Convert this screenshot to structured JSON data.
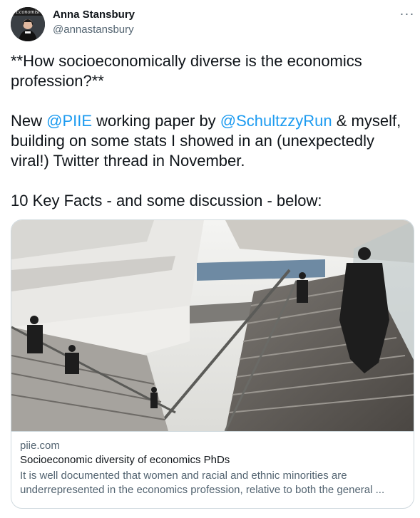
{
  "author": {
    "name": "Anna Stansbury",
    "handle": "@annastansbury",
    "avatar_icon": "person-with-economist-banner"
  },
  "more_button": {
    "label": "···",
    "icon": "more-horizontal-icon"
  },
  "tweet": {
    "line1": "**How socioeconomically diverse is the economics profession?**",
    "line2_prefix": "New ",
    "mention1": "@PIIE",
    "line2_mid": " working paper by ",
    "mention2": "@SchultzzyRun",
    "line2_suffix": " & myself, building on some stats I showed in an (unexpectedly viral!) Twitter thread in November.",
    "line3": "10 Key Facts - and some discussion - below:"
  },
  "card": {
    "image_description_icon": "building-staircase-photo",
    "domain": "piie.com",
    "title": "Socioeconomic diversity of economics PhDs",
    "description": "It is well documented that women and racial and ethnic minorities are underrepresented in the economics profession, relative to both the general ..."
  },
  "colors": {
    "link": "#1d9bf0",
    "text": "#0f1419",
    "secondary": "#536471",
    "border": "#cfd9de"
  }
}
